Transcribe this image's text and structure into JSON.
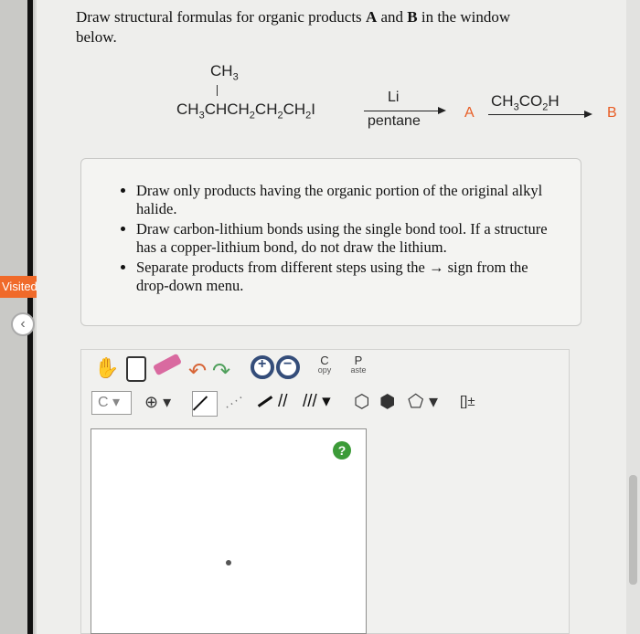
{
  "sidebar": {
    "visited_label": "Visited"
  },
  "question": {
    "line1_a": "Draw structural formulas for organic products ",
    "line1_a2": "A",
    "line1_and": " and ",
    "line1_b": "B",
    "line1_end": " in the window",
    "line2": "below."
  },
  "reaction": {
    "methyl": "CH3",
    "reactant": "CH3CHCH2CH2CH2I",
    "reagent_top": "Li",
    "reagent_bottom": "pentane",
    "product_a": "A",
    "reagent2": "CH3CO2H",
    "product_b": "B"
  },
  "instructions": [
    "Draw only products having the organic portion of the original alkyl halide.",
    "Draw carbon-lithium bonds using the single bond tool. If a structure has a copper-lithium bond, do not draw the lithium.",
    "Separate products from different steps using the → sign from the drop-down menu."
  ],
  "toolbar": {
    "copy_top": "C",
    "copy_bottom": "opy",
    "paste_top": "P",
    "paste_bottom": "aste",
    "element_select": "C",
    "plus_select": "⊕",
    "bracket": "[]±",
    "help": "?"
  },
  "icons": [
    "hand-icon",
    "template-icon",
    "eraser-icon",
    "undo-icon",
    "redo-icon",
    "zoom-in-icon",
    "zoom-out-icon"
  ]
}
